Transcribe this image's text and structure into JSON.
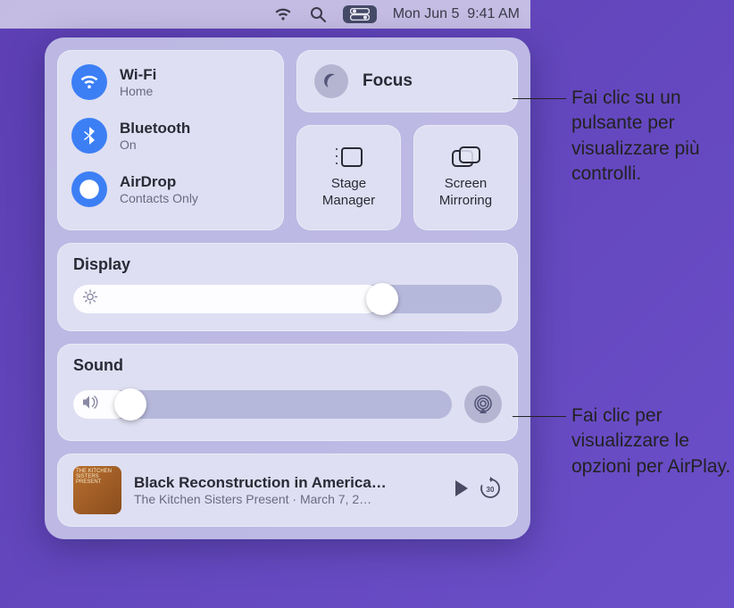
{
  "menubar": {
    "date": "Mon Jun 5",
    "time": "9:41 AM"
  },
  "connectivity": {
    "wifi": {
      "title": "Wi-Fi",
      "sub": "Home"
    },
    "bluetooth": {
      "title": "Bluetooth",
      "sub": "On"
    },
    "airdrop": {
      "title": "AirDrop",
      "sub": "Contacts Only"
    }
  },
  "focus": {
    "label": "Focus"
  },
  "stage": {
    "line1": "Stage",
    "line2": "Manager"
  },
  "mirror": {
    "line1": "Screen",
    "line2": "Mirroring"
  },
  "display": {
    "label": "Display",
    "value_pct": 72
  },
  "sound": {
    "label": "Sound",
    "value_pct": 15
  },
  "nowplaying": {
    "art_caption": "The Kitchen Sisters Present",
    "title": "Black Reconstruction in America…",
    "subtitle": "The Kitchen Sisters Present · March 7, 2…"
  },
  "callouts": {
    "top": "Fai clic su un pulsante per visualizzare più controlli.",
    "bottom": "Fai clic per visualizzare le opzioni per AirPlay."
  }
}
